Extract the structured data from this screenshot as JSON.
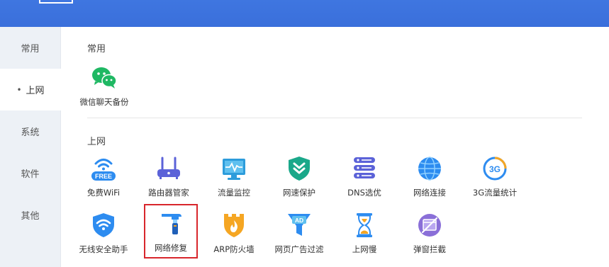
{
  "sidebar": {
    "items": [
      {
        "label": "常用",
        "active": false
      },
      {
        "label": "上网",
        "active": true,
        "bullet": "•"
      },
      {
        "label": "系统",
        "active": false
      },
      {
        "label": "软件",
        "active": false
      },
      {
        "label": "其他",
        "active": false
      }
    ]
  },
  "sections": {
    "common": {
      "title": "常用",
      "tools": [
        {
          "label": "微信聊天备份",
          "icon": "wechat-icon",
          "color": "#1fb863"
        }
      ]
    },
    "internet": {
      "title": "上网",
      "tools": [
        {
          "label": "免费WiFi",
          "icon": "free-wifi-icon",
          "color": "#2d8cf0"
        },
        {
          "label": "路由器管家",
          "icon": "router-icon",
          "color": "#5b62d8"
        },
        {
          "label": "流量监控",
          "icon": "monitor-icon",
          "color": "#2d9cdb"
        },
        {
          "label": "网速保护",
          "icon": "shield-icon",
          "color": "#1aa88a"
        },
        {
          "label": "DNS选优",
          "icon": "server-icon",
          "color": "#5b62d8"
        },
        {
          "label": "网络连接",
          "icon": "globe-icon",
          "color": "#2d8cf0"
        },
        {
          "label": "3G流量统计",
          "icon": "3g-icon",
          "color": "#2d8cf0",
          "badge": "3G"
        },
        {
          "label": "无线安全助手",
          "icon": "wifi-shield-icon",
          "color": "#2d8cf0"
        },
        {
          "label": "网络修复",
          "icon": "repair-hammer-icon",
          "color": "#2d8cf0",
          "selected": true
        },
        {
          "label": "ARP防火墙",
          "icon": "firewall-icon",
          "color": "#f5a623"
        },
        {
          "label": "网页广告过滤",
          "icon": "ad-filter-icon",
          "color": "#2d8cf0",
          "badge": "AD"
        },
        {
          "label": "上网慢",
          "icon": "hourglass-icon",
          "color": "#2d8cf0"
        },
        {
          "label": "弹窗拦截",
          "icon": "popup-block-icon",
          "color": "#8a6fd8"
        }
      ],
      "free_badge": "FREE"
    }
  },
  "colors": {
    "header": "#3a6fdb",
    "sidebar_bg": "#edf1f6",
    "highlight_border": "#d8262c"
  }
}
